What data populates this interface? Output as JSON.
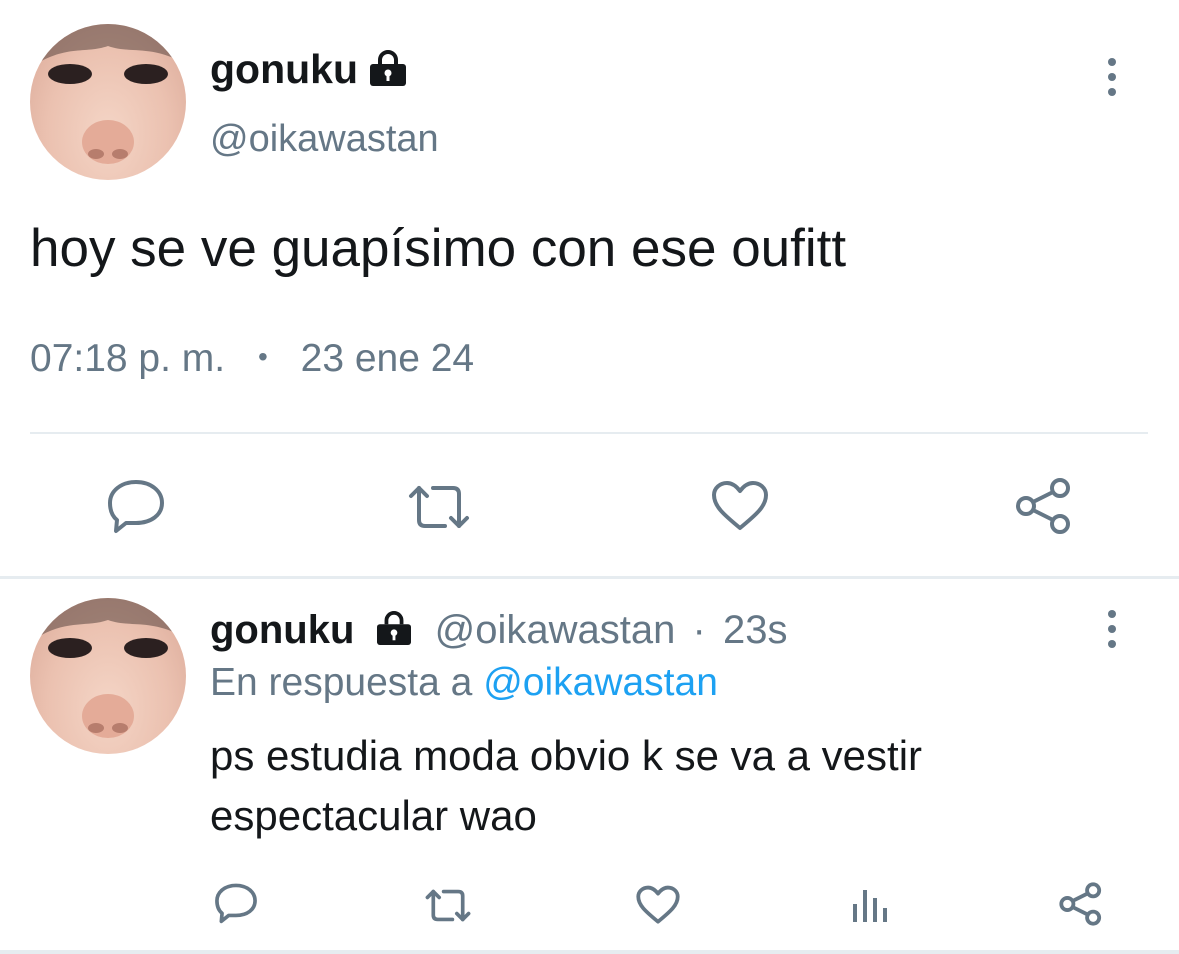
{
  "main_tweet": {
    "display_name": "gonuku",
    "handle": "@oikawastan",
    "text": "hoy se ve guapísimo con ese oufitt",
    "time": "07:18 p. m.",
    "separator": "•",
    "date": "23 ene 24",
    "protected_icon": "lock-icon",
    "actions": [
      "reply-icon",
      "retweet-icon",
      "like-icon",
      "share-icon"
    ]
  },
  "reply_tweet": {
    "display_name": "gonuku",
    "handle": "@oikawastan",
    "dot": "·",
    "age": "23s",
    "reply_prefix": "En respuesta a",
    "reply_to": "@oikawastan",
    "text_line1": "ps estudia moda obvio k se va a vestir",
    "text_line2": "espectacular wao",
    "protected_icon": "lock-icon",
    "actions": [
      "reply-icon",
      "retweet-icon",
      "like-icon",
      "analytics-icon",
      "share-icon"
    ]
  },
  "colors": {
    "text": "#14171a",
    "muted": "#657786",
    "link": "#1da1f2",
    "divider": "#e6ecf0"
  }
}
